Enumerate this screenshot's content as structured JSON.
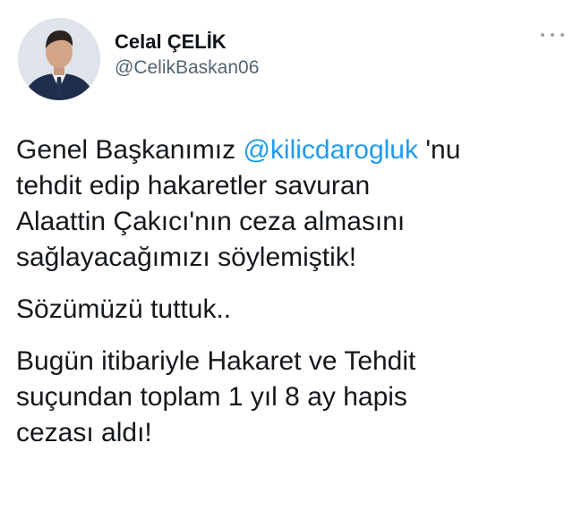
{
  "author": {
    "name": "Celal ÇELİK",
    "handle": "@CelikBaskan06"
  },
  "menu": {
    "icon": "more-horizontal-icon"
  },
  "colors": {
    "mention": "#1d9bf0",
    "handle": "#536471",
    "text": "#14181c"
  },
  "tweet": {
    "p1": {
      "l1_before": "Genel Başkanımız ",
      "mention": "@kilicdarogluk",
      "l1_after": " 'nu",
      "l2": "tehdit edip hakaretler savuran",
      "l3": "Alaattin Çakıcı'nın ceza almasını",
      "l4": "sağlayacağımızı söylemiştik!"
    },
    "p2": {
      "l1": "Sözümüzü tuttuk.."
    },
    "p3": {
      "l1": "Bugün itibariyle Hakaret ve Tehdit",
      "l2": "suçundan toplam 1 yıl 8 ay hapis",
      "l3": "cezası aldı!"
    }
  }
}
